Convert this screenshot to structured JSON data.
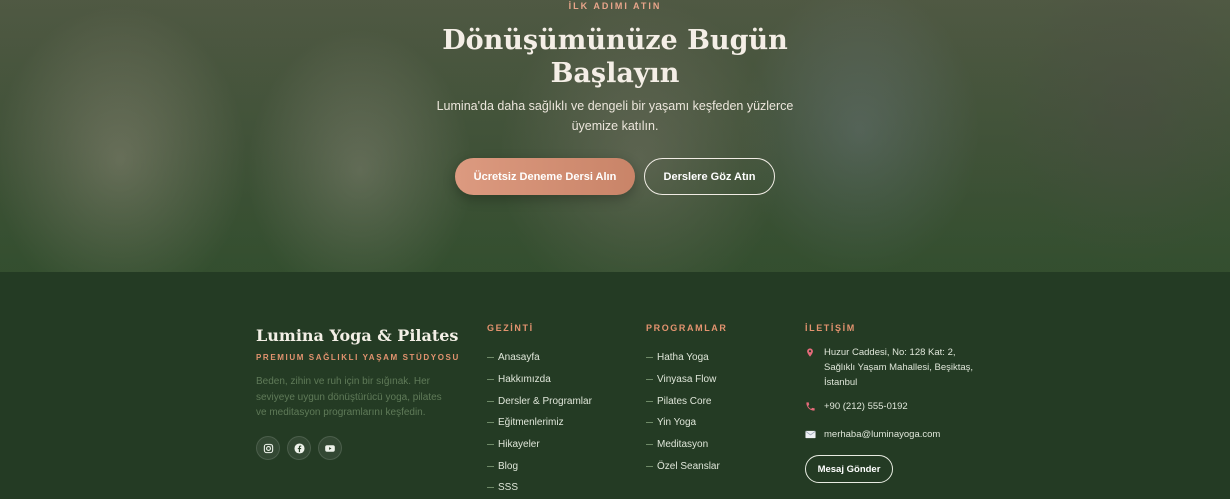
{
  "hero": {
    "eyebrow": "İLK ADIMI ATIN",
    "title": "Dönüşümünüze Bugün Başlayın",
    "subtitle": "Lumina'da daha sağlıklı ve dengeli bir yaşamı keşfeden yüzlerce üyemize katılın.",
    "primary_button": "Ücretsiz Deneme Dersi Alın",
    "secondary_button": "Derslere Göz Atın"
  },
  "footer": {
    "brand": {
      "name": "Lumina Yoga & Pilates",
      "tagline": "PREMIUM SAĞLIKLI YAŞAM STÜDYOSU",
      "description": "Beden, zihin ve ruh için bir sığınak. Her seviyeye uygun dönüştürücü yoga, pilates ve meditasyon programlarını keşfedin.",
      "socials": [
        "instagram-icon",
        "facebook-icon",
        "youtube-icon"
      ]
    },
    "nav": {
      "heading": "GEZİNTİ",
      "items": [
        "Anasayfa",
        "Hakkımızda",
        "Dersler & Programlar",
        "Eğitmenlerimiz",
        "Hikayeler",
        "Blog",
        "SSS"
      ]
    },
    "programs": {
      "heading": "PROGRAMLAR",
      "items": [
        "Hatha Yoga",
        "Vinyasa Flow",
        "Pilates Core",
        "Yin Yoga",
        "Meditasyon",
        "Özel Seanslar"
      ]
    },
    "contact": {
      "heading": "İLETİŞİM",
      "address": "Huzur Caddesi, No: 128 Kat: 2, Sağlıklı Yaşam Mahallesi, Beşiktaş, İstanbul",
      "phone": "+90 (212) 555-0192",
      "email": "merhaba@luminayoga.com",
      "button": "Mesaj Gönder"
    }
  },
  "colors": {
    "accent": "#e3936f",
    "footer_bg": "#243b24",
    "primary_button": "#d4917a"
  }
}
